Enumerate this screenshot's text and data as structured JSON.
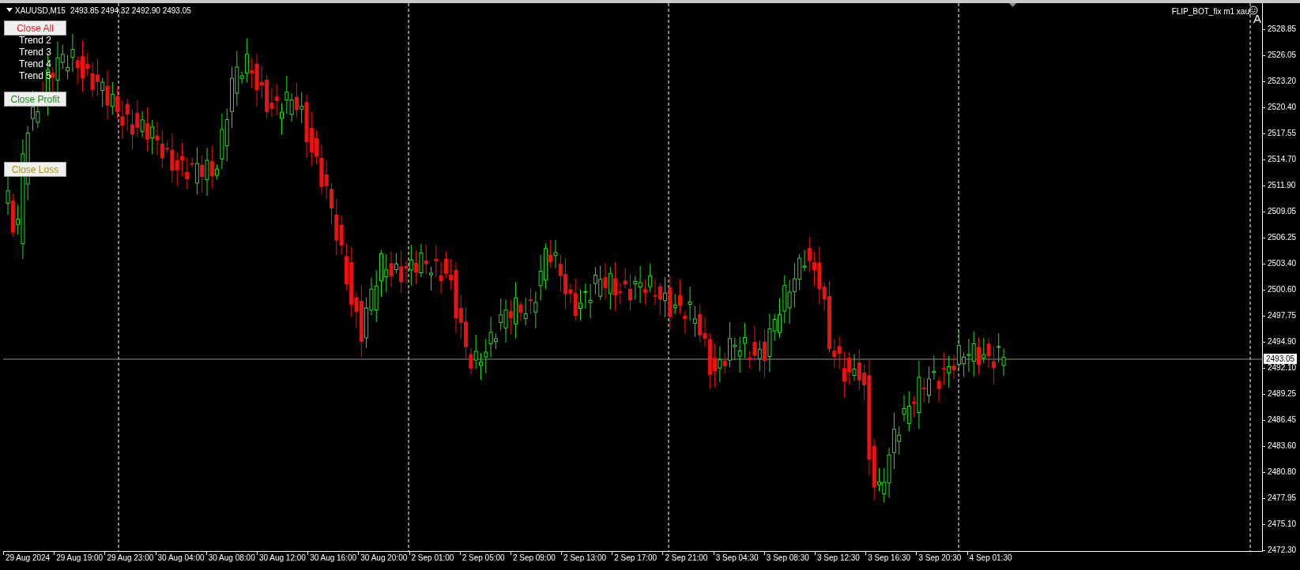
{
  "chart": {
    "symbol": "XAUUSD,M15",
    "ohlc": "2493.85 2494.32 2492.90 2493.05",
    "expert_label": "FLIP_BOT_fix m1 xau",
    "auto_trading_mark": "A",
    "current_price": "2493.05"
  },
  "buttons": [
    {
      "label": "Close All",
      "color": "#e8202a"
    },
    {
      "label": "Close Profit",
      "color": "#1e8a1e"
    },
    {
      "label": "Close Loss",
      "color": "#a89300"
    }
  ],
  "trend_labels": [
    "Trend 2",
    "Trend 3",
    "Trend 4",
    "Trend 5"
  ],
  "price_axis": [
    "2528.85",
    "2526.05",
    "2523.20",
    "2520.40",
    "2517.55",
    "2514.70",
    "2511.90",
    "2509.05",
    "2506.25",
    "2503.40",
    "2500.60",
    "2497.75",
    "2494.90",
    "2492.10",
    "2489.25",
    "2486.45",
    "2483.60",
    "2480.80",
    "2477.95",
    "2475.10",
    "2472.30"
  ],
  "time_axis": [
    "29 Aug 2024",
    "29 Aug 19:00",
    "29 Aug 23:00",
    "30 Aug 04:00",
    "30 Aug 08:00",
    "30 Aug 12:00",
    "30 Aug 16:00",
    "30 Aug 20:00",
    "2 Sep 01:00",
    "2 Sep 05:00",
    "2 Sep 09:00",
    "2 Sep 13:00",
    "2 Sep 17:00",
    "2 Sep 21:00",
    "3 Sep 04:30",
    "3 Sep 08:30",
    "3 Sep 12:30",
    "3 Sep 16:30",
    "3 Sep 20:30",
    "4 Sep 01:30"
  ]
}
